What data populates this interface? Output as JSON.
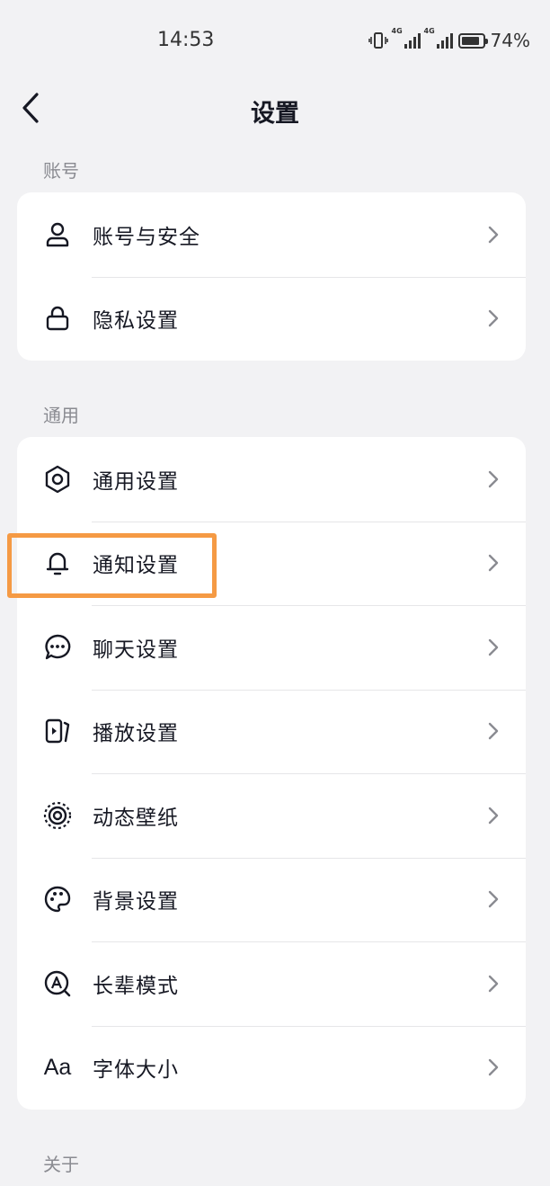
{
  "status": {
    "time": "14:53",
    "battery_text": "74%",
    "battery_level": 0.74,
    "net_tag": "4G"
  },
  "nav": {
    "title": "设置",
    "back_icon": "chevron-left-icon"
  },
  "sections": [
    {
      "label": "账号",
      "items": [
        {
          "label": "账号与安全",
          "icon": "user-icon"
        },
        {
          "label": "隐私设置",
          "icon": "lock-icon"
        }
      ]
    },
    {
      "label": "通用",
      "items": [
        {
          "label": "通用设置",
          "icon": "gear-icon"
        },
        {
          "label": "通知设置",
          "icon": "bell-icon"
        },
        {
          "label": "聊天设置",
          "icon": "chat-bubble-icon"
        },
        {
          "label": "播放设置",
          "icon": "play-card-icon"
        },
        {
          "label": "动态壁纸",
          "icon": "target-icon"
        },
        {
          "label": "背景设置",
          "icon": "palette-icon"
        },
        {
          "label": "长辈模式",
          "icon": "elder-mode-icon"
        },
        {
          "label": "字体大小",
          "icon": "font-size-icon",
          "icon_text": "Aa"
        }
      ]
    },
    {
      "label": "关于",
      "items": []
    }
  ],
  "highlight": {
    "target": "通知设置",
    "color": "#f59a44"
  },
  "colors": {
    "background": "#f2f2f4",
    "card": "#ffffff",
    "text": "#161823",
    "section_label": "#8a8b91",
    "chevron": "#8a8b91"
  }
}
